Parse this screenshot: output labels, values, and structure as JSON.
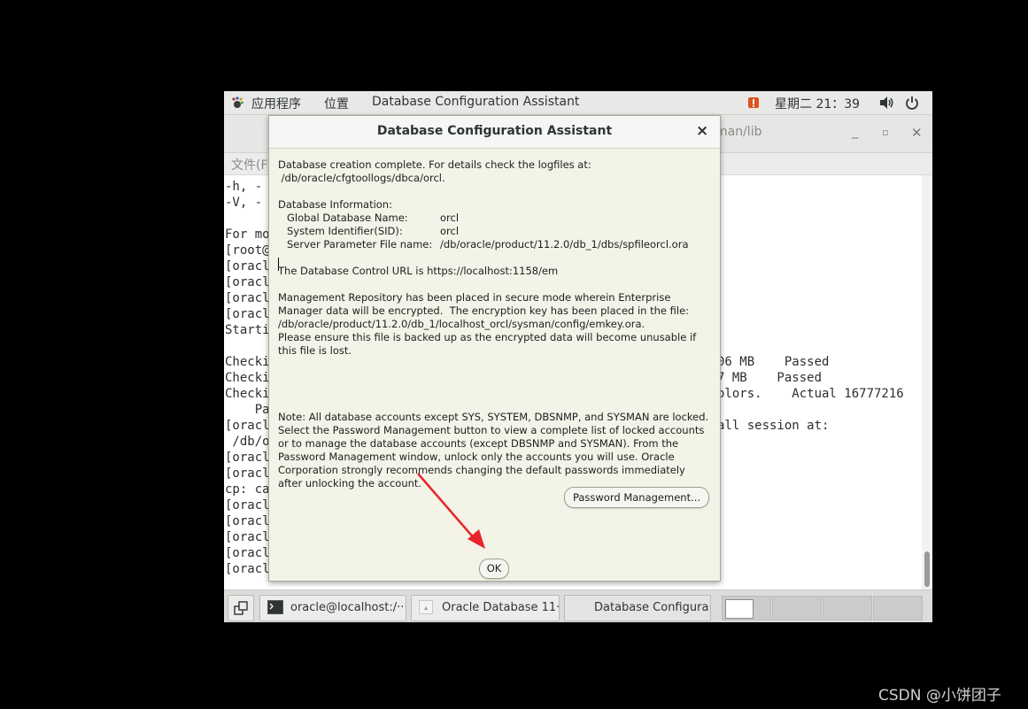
{
  "top_panel": {
    "applications": "应用程序",
    "places": "位置",
    "active_app": "Database Configuration Assistant",
    "clock": "星期二 21：39"
  },
  "terminal": {
    "title_fragment": "man/lib",
    "menu_fragment": "文件(F",
    "lines": [
      "-h, -",
      "-V, -",
      "",
      "For mo",
      "[root@",
      "[oracl",
      "[oracl",
      "[oracl",
      "[oracl",
      "Starti",
      "",
      "Checki",
      "Checki",
      "Checki",
      "    Pa",
      "[oracl",
      " /db/o",
      "[oracl",
      "[oracl",
      "cp: ca",
      "[oracl",
      "[oracl",
      "[oracl",
      "[oracl",
      "[oracl"
    ],
    "right_fragments": [
      {
        "row": 11,
        "text": "06 MB    Passed"
      },
      {
        "row": 12,
        "text": "7 MB    Passed"
      },
      {
        "row": 13,
        "text": "olors.    Actual 16777216"
      },
      {
        "row": 15,
        "text": "all session at:"
      }
    ]
  },
  "dialog": {
    "title": "Database Configuration Assistant",
    "close_symbol": "×",
    "completion_line1": "Database creation complete. For details check the logfiles at:",
    "completion_line2": " /db/oracle/cfgtoollogs/dbca/orcl.",
    "info_header": "Database Information:",
    "info": [
      {
        "label": "Global Database Name:",
        "value": "orcl"
      },
      {
        "label": "System Identifier(SID):",
        "value": "orcl"
      },
      {
        "label": "Server Parameter File name:",
        "value": "/db/oracle/product/11.2.0/db_1/dbs/spfileorcl.ora"
      }
    ],
    "control_url": "The Database Control URL is https://localhost:1158/em",
    "repository_lines": [
      "Management Repository has been placed in secure mode wherein Enterprise",
      "Manager data will be encrypted.  The encryption key has been placed in the file:",
      "/db/oracle/product/11.2.0/db_1/localhost_orcl/sysman/config/emkey.ora.",
      "Please ensure this file is backed up as the encrypted data will become unusable if",
      "this file is lost."
    ],
    "note_lines": [
      "Note: All database accounts except SYS, SYSTEM, DBSNMP, and SYSMAN are locked.",
      "Select the Password Management button to view a complete list of locked accounts",
      "or to manage the database accounts (except DBSNMP and SYSMAN). From the",
      "Password Management window, unlock only the accounts you will use. Oracle",
      "Corporation strongly recommends changing the default passwords immediately",
      "after unlocking the account."
    ],
    "password_button": "Password Management...",
    "ok_button": "OK"
  },
  "taskbar": {
    "items": [
      {
        "label": "oracle@localhost:/···"
      },
      {
        "label": "Oracle Database 11···"
      },
      {
        "label": "Database Configura···"
      }
    ]
  },
  "watermark": "CSDN @小饼团子",
  "colors": {
    "dialog_background": "#f3f3e8",
    "annotation_arrow": "#e8262a",
    "panel_background": "#e8e8e7"
  },
  "icons": [
    "gnome-foot-icon",
    "alert-icon",
    "volume-icon",
    "power-icon",
    "minimize-icon",
    "maximize-icon",
    "close-icon",
    "terminal-icon",
    "java-app-icon",
    "show-desktop-icon"
  ]
}
